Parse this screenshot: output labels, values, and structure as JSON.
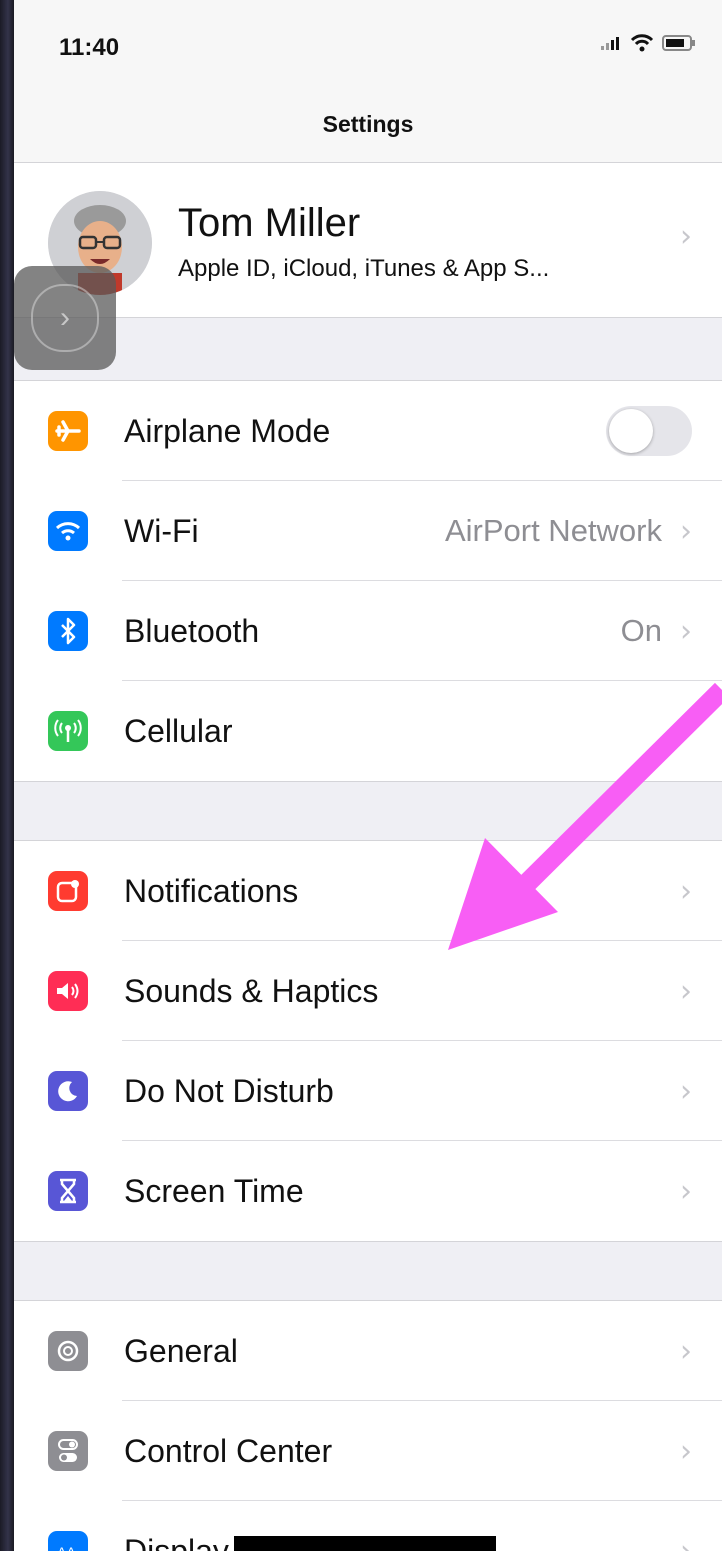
{
  "status_bar": {
    "time": "11:40"
  },
  "nav": {
    "title": "Settings"
  },
  "profile": {
    "name": "Tom Miller",
    "subtitle": "Apple ID, iCloud, iTunes & App S..."
  },
  "group1": [
    {
      "label": "Airplane Mode",
      "icon": "airplane-icon",
      "color": "#ff9500",
      "control": "toggle",
      "toggle_on": false
    },
    {
      "label": "Wi-Fi",
      "value": "AirPort Network",
      "icon": "wifi-icon",
      "color": "#007aff"
    },
    {
      "label": "Bluetooth",
      "value": "On",
      "icon": "bluetooth-icon",
      "color": "#007aff"
    },
    {
      "label": "Cellular",
      "icon": "cellular-icon",
      "color": "#34c759"
    }
  ],
  "group2": [
    {
      "label": "Notifications",
      "icon": "notifications-icon",
      "color": "#ff3b30"
    },
    {
      "label": "Sounds & Haptics",
      "icon": "speaker-icon",
      "color": "#ff2d55"
    },
    {
      "label": "Do Not Disturb",
      "icon": "moon-icon",
      "color": "#5856d6"
    },
    {
      "label": "Screen Time",
      "icon": "hourglass-icon",
      "color": "#5856d6"
    }
  ],
  "group3": [
    {
      "label": "General",
      "icon": "gear-icon",
      "color": "#8e8e93"
    },
    {
      "label": "Control Center",
      "icon": "toggles-icon",
      "color": "#8e8e93"
    },
    {
      "label": "Display & Brightness",
      "icon": "display-icon",
      "color": "#007aff"
    }
  ],
  "colors": {
    "arrow": "#f85ef5"
  }
}
